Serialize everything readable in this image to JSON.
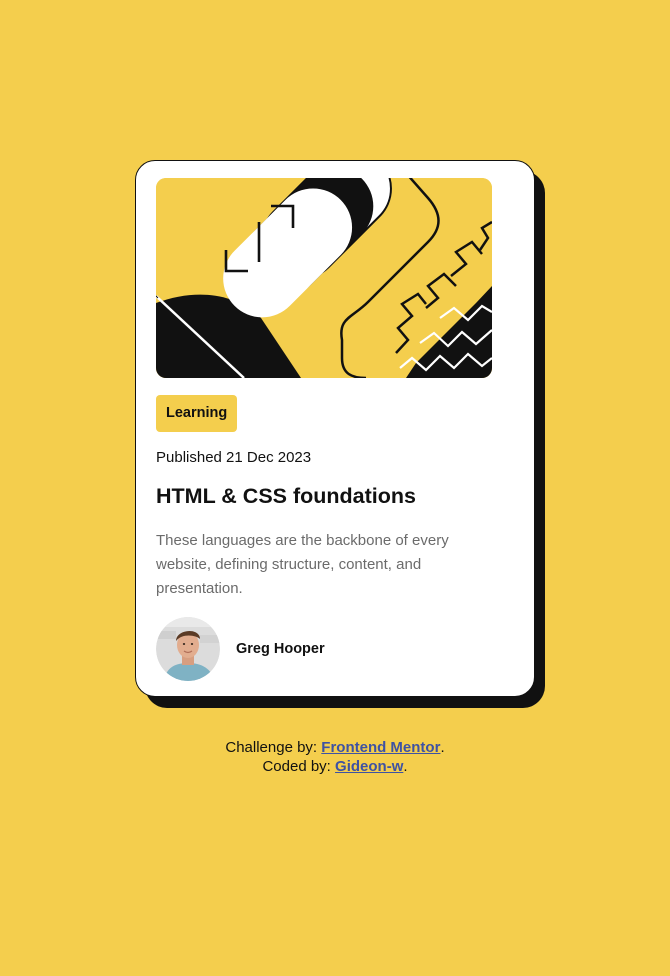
{
  "card": {
    "tag": "Learning",
    "published": "Published 21 Dec 2023",
    "title": "HTML & CSS foundations",
    "description": "These languages are the backbone of every website, defining structure, content, and presentation.",
    "author": {
      "name": "Greg Hooper"
    }
  },
  "attribution": {
    "challenge_prefix": "Challenge by:",
    "challenge_link": "Frontend Mentor",
    "coded_prefix": "Coded by:",
    "coded_link": "Gideon-w",
    "period": "."
  },
  "colors": {
    "background": "#f4ce4d",
    "card": "#ffffff",
    "ink": "#111111",
    "muted_text": "#6b6b6b",
    "link": "#3e52a3"
  },
  "icons": {
    "hero": "abstract-illustration",
    "avatar": "author-photo"
  }
}
